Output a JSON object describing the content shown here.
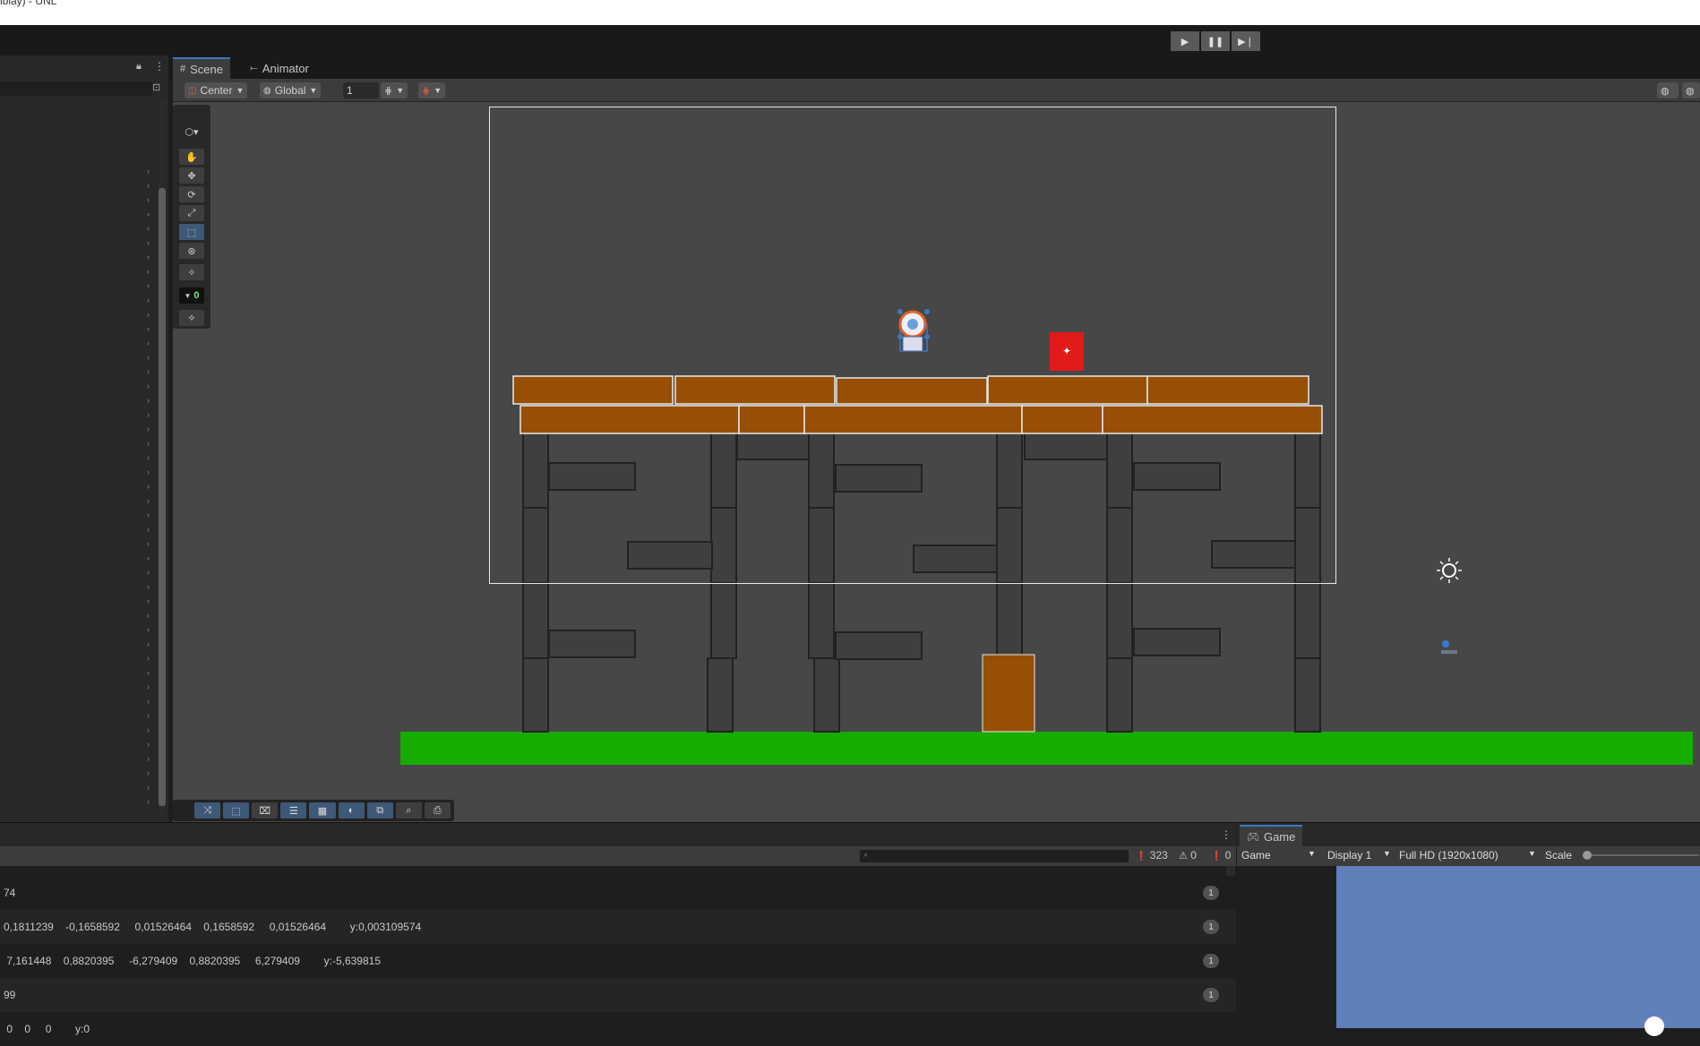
{
  "window": {
    "title_fragment": "iblay) - UNL"
  },
  "play_controls": {
    "play": "▶",
    "pause": "❚❚",
    "step": "▶❘"
  },
  "hierarchy": {
    "lock_icon": "lock-icon",
    "menu_icon": "kebab-menu-icon",
    "chevron": "›"
  },
  "tabs": {
    "scene_label": "Scene",
    "animator_label": "Animator",
    "game_label": "Game"
  },
  "scene_toolbar": {
    "pivot_mode": "Center",
    "pivot_rotation": "Global",
    "grid_size": "1"
  },
  "tool_panel": {
    "counter_value": "0"
  },
  "console": {
    "count_logs": "323",
    "count_warnings": "0",
    "count_errors": "0",
    "rows": [
      {
        "text": "74",
        "count": "1"
      },
      {
        "text": "0,1811239    -0,1658592     0,01526464    0,1658592     0,01526464        y:0,003109574",
        "count": "1"
      },
      {
        "text": " 7,161448    0,8820395     -6,279409    0,8820395     6,279409        y:-5,639815",
        "count": "1"
      },
      {
        "text": "99",
        "count": "1"
      },
      {
        "text": " 0    0     0        y:0",
        "count": ""
      }
    ]
  },
  "game_view": {
    "view_mode": "Game",
    "display": "Display 1",
    "resolution": "Full HD (1920x1080)",
    "scale_label": "Scale"
  },
  "colors": {
    "wood": "#964f04",
    "grass": "#17ac00",
    "block": "#3f3f3f",
    "enemy_box": "#e11a1a",
    "game_background": "#5f80ba",
    "selection_blue": "#3a79bb"
  }
}
